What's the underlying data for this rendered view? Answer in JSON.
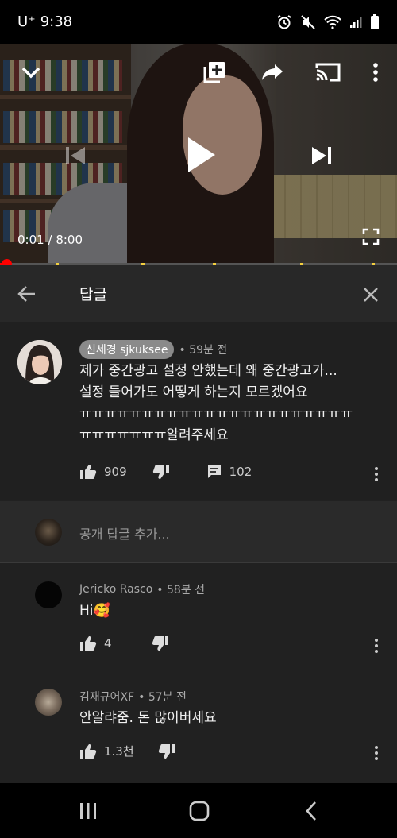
{
  "status_bar": {
    "carrier": "U⁺",
    "time": "9:38"
  },
  "video": {
    "current_time": "0:01",
    "separator": "/",
    "duration": "8:00",
    "progress_fraction": 0.002
  },
  "replies_panel": {
    "title": "답글"
  },
  "parent_comment": {
    "author": "신세경 sjkuksee",
    "time_ago": "• 59분 전",
    "text": "제가 중간광고 설정 안했는데 왜 중간광고가...\n설정 들어가도 어떻게 하는지 모르겠어요\nㅠㅠㅠㅠㅠㅠㅠㅠㅠㅠㅠㅠㅠㅠㅠㅠㅠㅠㅠㅠㅠㅠ\nㅠㅠㅠㅠㅠㅠㅠ알려주세요",
    "likes": "909",
    "reply_count": "102"
  },
  "add_reply": {
    "placeholder": "공개 답글 추가..."
  },
  "replies": [
    {
      "author": "Jericko Rasco",
      "time_ago": "• 58분 전",
      "text": "Hi🥰",
      "likes": "4"
    },
    {
      "author": "김재규어XF",
      "time_ago": "• 57분 전",
      "text": "안알랴줌. 돈 많이버세요",
      "likes": "1.3천"
    }
  ],
  "colors": {
    "background": "#212121",
    "header": "#282828",
    "progress": "#ff0000",
    "ad_marker": "#f4d03f"
  },
  "icons": [
    "alarm-icon",
    "mute-icon",
    "wifi-icon",
    "signal-icon",
    "battery-icon",
    "collapse-icon",
    "add-to-playlist-icon",
    "share-icon",
    "cast-icon",
    "more-icon",
    "previous-icon",
    "play-icon",
    "next-icon",
    "fullscreen-icon",
    "back-arrow-icon",
    "close-icon",
    "thumbs-up-icon",
    "thumbs-down-icon",
    "reply-icon",
    "recents-icon",
    "home-icon",
    "back-icon"
  ]
}
